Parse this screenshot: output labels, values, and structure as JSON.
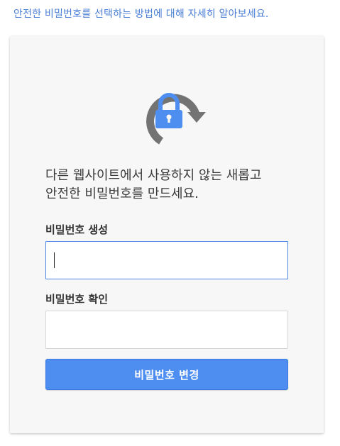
{
  "help": {
    "link_text": "안전한 비밀번호를 선택하는 방법에 대해 자세히 알아보세요."
  },
  "card": {
    "icon": "password-refresh-lock-icon",
    "intro_line1": "다른 웹사이트에서 사용하지 않는 새롭고",
    "intro_line2": "안전한 비밀번호를 만드세요.",
    "new_password": {
      "label": "비밀번호 생성",
      "value": ""
    },
    "confirm_password": {
      "label": "비밀번호 확인",
      "value": ""
    },
    "submit_label": "비밀번호 변경"
  },
  "colors": {
    "link": "#4b7fd6",
    "accent": "#4d8ef0",
    "icon_arrow": "#737373",
    "icon_lock": "#4d8ef0"
  }
}
